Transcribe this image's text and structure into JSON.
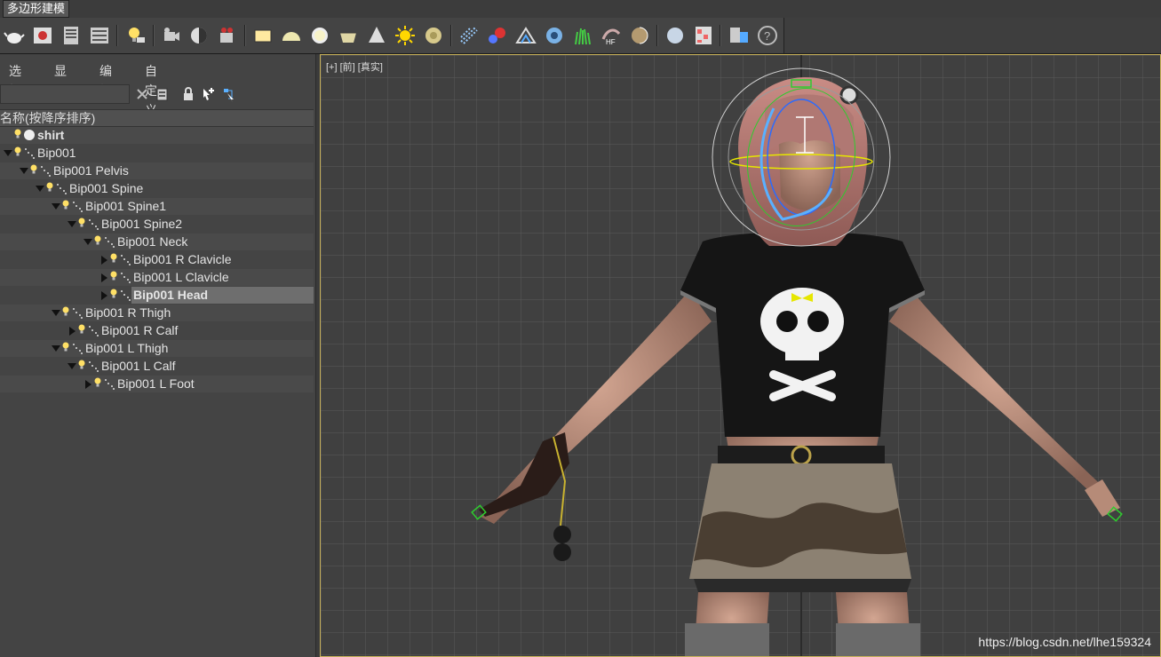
{
  "ribbon": {
    "tab_label": "多边形建模"
  },
  "toolbar": {
    "icons": [
      "teapot-icon",
      "render-frame-icon",
      "layer-list-icon",
      "layer-table-icon",
      "lightbulb-cursor-icon",
      "camera-move-icon",
      "sphere-half-icon",
      "film-camera-icon",
      "plane-icon",
      "dome-icon",
      "ring-icon",
      "pot-icon",
      "cone-icon",
      "sun-icon",
      "disk-icon",
      "grid-dots-icon",
      "atom-icon",
      "tent-icon",
      "gear-flower-icon",
      "grass-icon",
      "hair-icon",
      "shell-icon",
      "material-sphere-icon",
      "checker-icon",
      "export-icon",
      "help-icon"
    ]
  },
  "explorer": {
    "menu": [
      "选择",
      "显示",
      "编辑",
      "自定义"
    ],
    "search": {
      "value": "",
      "placeholder": ""
    },
    "column_header": "名称(按降序排序)",
    "rows": [
      {
        "label": "shirt",
        "bold": true,
        "selected": false,
        "expander": "none",
        "indent": 0
      },
      {
        "label": "Bip001",
        "bold": false,
        "selected": false,
        "expander": "down",
        "indent": 0
      },
      {
        "label": "Bip001 Pelvis",
        "bold": false,
        "selected": false,
        "expander": "down",
        "indent": 1
      },
      {
        "label": "Bip001 Spine",
        "bold": false,
        "selected": false,
        "expander": "down",
        "indent": 2
      },
      {
        "label": "Bip001 Spine1",
        "bold": false,
        "selected": false,
        "expander": "down",
        "indent": 3
      },
      {
        "label": "Bip001 Spine2",
        "bold": false,
        "selected": false,
        "expander": "down",
        "indent": 4
      },
      {
        "label": "Bip001 Neck",
        "bold": false,
        "selected": false,
        "expander": "down",
        "indent": 5
      },
      {
        "label": "Bip001 R Clavicle",
        "bold": false,
        "selected": false,
        "expander": "right",
        "indent": 6
      },
      {
        "label": "Bip001 L Clavicle",
        "bold": false,
        "selected": false,
        "expander": "right",
        "indent": 6
      },
      {
        "label": "Bip001 Head",
        "bold": true,
        "selected": true,
        "expander": "right",
        "indent": 6
      },
      {
        "label": "Bip001 R Thigh",
        "bold": false,
        "selected": false,
        "expander": "down",
        "indent": 3
      },
      {
        "label": "Bip001 R Calf",
        "bold": false,
        "selected": false,
        "expander": "right",
        "indent": 4
      },
      {
        "label": "Bip001 L Thigh",
        "bold": false,
        "selected": false,
        "expander": "down",
        "indent": 3
      },
      {
        "label": "Bip001 L Calf",
        "bold": false,
        "selected": false,
        "expander": "down",
        "indent": 4
      },
      {
        "label": "Bip001 L Foot",
        "bold": false,
        "selected": false,
        "expander": "right",
        "indent": 5
      }
    ]
  },
  "viewport": {
    "label": "[+] [前] [真实]",
    "watermark": "https://blog.csdn.net/lhe159324"
  },
  "colors": {
    "selection": "#6e6e6e",
    "viewport_border": "#c8b25a",
    "gizmo_yellow": "#e6e600",
    "gizmo_blue": "#2a6bff",
    "gizmo_green": "#2ecc2e"
  }
}
